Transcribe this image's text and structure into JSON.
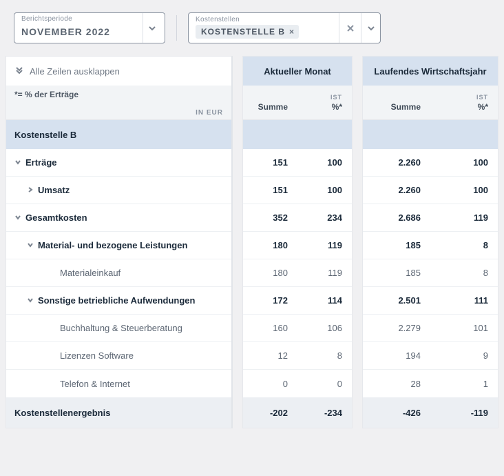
{
  "filters": {
    "period_label": "Berichtsperiode",
    "period_value": "NOVEMBER 2022",
    "cc_label": "Kostenstellen",
    "cc_chip": "KOSTENSTELLE B"
  },
  "header": {
    "expand_all": "Alle Zeilen ausklappen",
    "note": "*= % der Erträge",
    "unit": "IN EUR",
    "month_title": "Aktueller Monat",
    "year_title": "Laufendes Wirtschaftsjahr",
    "col_sum": "Summe",
    "col_ist": "IST",
    "col_pct": "%*",
    "cc_name": "Kostenstelle B"
  },
  "rows": [
    {
      "label": "Erträge",
      "indent": 0,
      "chev": "down",
      "bold": true,
      "m_sum": "151",
      "m_pct": "100",
      "y_sum": "2.260",
      "y_pct": "100"
    },
    {
      "label": "Umsatz",
      "indent": 1,
      "chev": "right",
      "bold": true,
      "m_sum": "151",
      "m_pct": "100",
      "y_sum": "2.260",
      "y_pct": "100"
    },
    {
      "label": "Gesamtkosten",
      "indent": 0,
      "chev": "down",
      "bold": true,
      "m_sum": "352",
      "m_pct": "234",
      "y_sum": "2.686",
      "y_pct": "119"
    },
    {
      "label": "Material- und bezogene Leistungen",
      "indent": 1,
      "chev": "down",
      "bold": true,
      "m_sum": "180",
      "m_pct": "119",
      "y_sum": "185",
      "y_pct": "8"
    },
    {
      "label": "Materialeinkauf",
      "indent": 3,
      "chev": "",
      "bold": false,
      "m_sum": "180",
      "m_pct": "119",
      "y_sum": "185",
      "y_pct": "8"
    },
    {
      "label": "Sonstige betriebliche Aufwendungen",
      "indent": 1,
      "chev": "down",
      "bold": true,
      "m_sum": "172",
      "m_pct": "114",
      "y_sum": "2.501",
      "y_pct": "111"
    },
    {
      "label": "Buchhaltung & Steuerberatung",
      "indent": 3,
      "chev": "",
      "bold": false,
      "m_sum": "160",
      "m_pct": "106",
      "y_sum": "2.279",
      "y_pct": "101"
    },
    {
      "label": "Lizenzen Software",
      "indent": 3,
      "chev": "",
      "bold": false,
      "m_sum": "12",
      "m_pct": "8",
      "y_sum": "194",
      "y_pct": "9"
    },
    {
      "label": "Telefon & Internet",
      "indent": 3,
      "chev": "",
      "bold": false,
      "m_sum": "0",
      "m_pct": "0",
      "y_sum": "28",
      "y_pct": "1"
    }
  ],
  "total": {
    "label": "Kostenstellenergebnis",
    "m_sum": "-202",
    "m_pct": "-234",
    "y_sum": "-426",
    "y_pct": "-119"
  }
}
